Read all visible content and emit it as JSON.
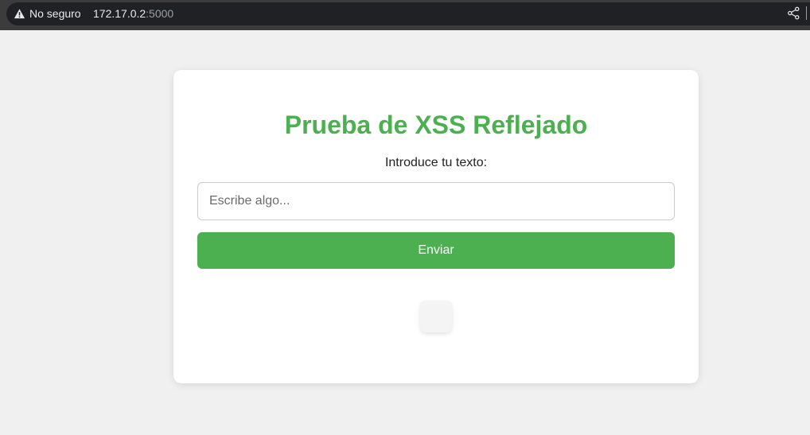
{
  "browser": {
    "security_label": "No seguro",
    "url_host": "172.17.0.2",
    "url_port": ":5000"
  },
  "icons": {
    "warning": "warning-triangle-icon",
    "share": "share-icon"
  },
  "page": {
    "title": "Prueba de XSS Reflejado",
    "input_label": "Introduce tu texto:",
    "input_placeholder": "Escribe algo...",
    "input_value": "",
    "submit_label": "Enviar",
    "result_text": ""
  },
  "colors": {
    "accent": "#4caf50",
    "background": "#f0f0f0",
    "card": "#ffffff"
  }
}
